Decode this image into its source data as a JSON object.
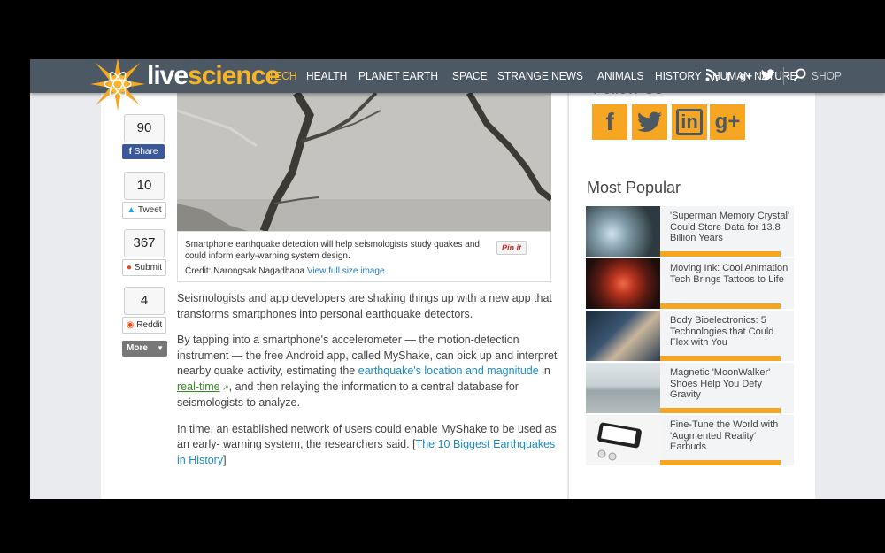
{
  "site": {
    "logo_left": "live",
    "logo_right": "science"
  },
  "nav": {
    "items": [
      "TECH",
      "HEALTH",
      "PLANET EARTH",
      "SPACE",
      "STRANGE NEWS",
      "ANIMALS",
      "HISTORY",
      "HUMAN NATURE",
      "SHOP"
    ]
  },
  "header_icons": [
    "rss-icon",
    "facebook-icon",
    "google-plus-icon",
    "twitter-icon",
    "search-icon"
  ],
  "share": {
    "facebook": {
      "count": "90",
      "label": "Share"
    },
    "twitter": {
      "count": "10",
      "label": "Tweet"
    },
    "stumbleupon": {
      "count": "367",
      "label": "Submit"
    },
    "reddit": {
      "count": "4",
      "label": "Reddit"
    },
    "more_label": "More"
  },
  "image": {
    "caption": "Smartphone earthquake detection will help seismologists study quakes and could inform early-warning system design.",
    "credit": "Credit: Narongsak Nagadhana",
    "full_size_link": "View full size image",
    "pin_label": "Pin it"
  },
  "article": {
    "p1": "Seismologists and app developers are shaking things up with a new app that transforms smartphones into personal earthquake detectors.",
    "p2a": "By tapping into a smartphone's accelerometer — the motion-detection instrument — the free Android app, called MyShake, can pick up and interpret nearby quake activity, estimating the ",
    "p2_link": "earthquake's location and magnitude",
    "p2b": " in ",
    "p2_link2": "real-time",
    "p2c": ", and then relaying the information to a central database for seismologists to analyze.",
    "p3a": "In time, an established network of users could enable MyShake to be used as an early- warning system, the researchers said. [",
    "p3_link": "The 10 Biggest Earthquakes in History",
    "p3b": "]"
  },
  "sidebar": {
    "follow_title": "Follow Us",
    "most_popular_title": "Most Popular",
    "items": [
      {
        "title": "'Superman Memory Crystal' Could Store Data for 13.8 Billion Years"
      },
      {
        "title": "Moving Ink: Cool Animation Tech Brings Tattoos to Life"
      },
      {
        "title": "Body Bioelectronics: 5 Technologies that Could Flex with You"
      },
      {
        "title": "Magnetic 'MoonWalker' Shoes Help You Defy Gravity"
      },
      {
        "title": "Fine-Tune the World with 'Augmented Reality' Earbuds"
      }
    ]
  },
  "colors": {
    "accent": "#f6a623",
    "header_bg": "#4d5865",
    "link": "#1e8ac4",
    "facebook": "#3b5998"
  }
}
